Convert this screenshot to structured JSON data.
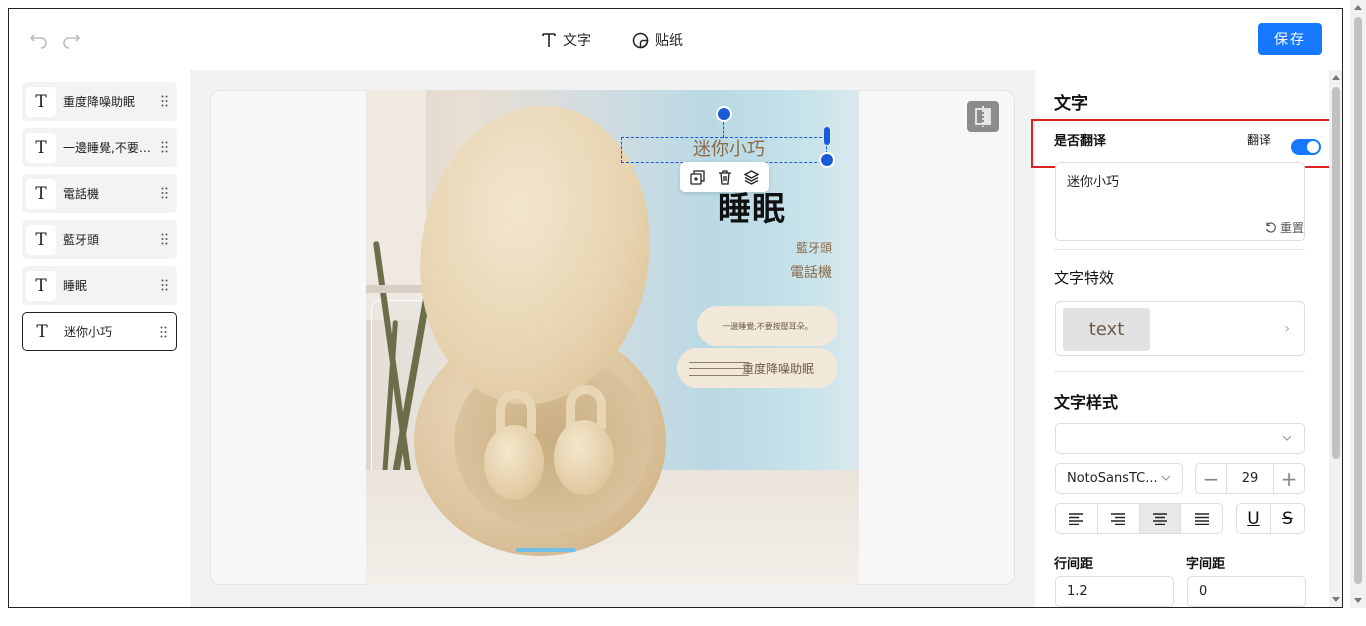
{
  "toolbar": {
    "text_tool_label": "文字",
    "sticker_tool_label": "贴纸",
    "save_label": "保存"
  },
  "layers": [
    {
      "label": "重度降噪助眠"
    },
    {
      "label": "一邊睡覺,不要壓到耳朵。"
    },
    {
      "label": "電話機"
    },
    {
      "label": "藍牙頭"
    },
    {
      "label": "睡眠"
    },
    {
      "label": "迷你小巧"
    }
  ],
  "poster": {
    "selected_text": "迷你小巧",
    "headline": "睡眠",
    "bluetooth": "藍牙頭",
    "phone": "電話機",
    "pill_small": "一邊睡覺,不要按壓耳朵。",
    "pill_large": "重度降噪助眠"
  },
  "panel": {
    "title": "文字",
    "translate_question": "是否翻译",
    "translate_label": "翻译",
    "text_value": "迷你小巧",
    "reset_label": "重置",
    "effect_title": "文字特效",
    "effect_sample": "text",
    "style_title": "文字样式",
    "font_family": "NotoSansTC...",
    "font_size": "29",
    "line_spacing_label": "行间距",
    "letter_spacing_label": "字间距",
    "line_spacing_value": "1.2",
    "letter_spacing_value": "0"
  },
  "colors": {
    "accent": "#1677ff",
    "highlight": "#e02020"
  }
}
